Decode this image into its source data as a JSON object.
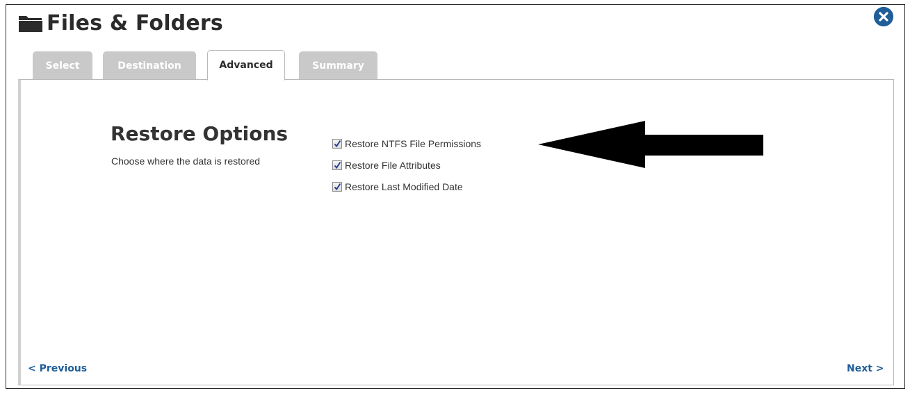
{
  "header": {
    "title": "Files & Folders",
    "icon": "folder-icon",
    "close_icon": "close-icon"
  },
  "tabs": [
    {
      "label": "Select",
      "state": "inactive"
    },
    {
      "label": "Destination",
      "state": "inactive"
    },
    {
      "label": "Advanced",
      "state": "active"
    },
    {
      "label": "Summary",
      "state": "inactive"
    }
  ],
  "section": {
    "heading": "Restore Options",
    "subtext": "Choose where the data is restored"
  },
  "options": [
    {
      "label": "Restore NTFS File Permissions",
      "checked": true
    },
    {
      "label": "Restore File Attributes",
      "checked": true
    },
    {
      "label": "Restore Last Modified Date",
      "checked": true
    }
  ],
  "annotation": {
    "arrow_icon": "arrow-left-icon",
    "arrow_color": "#000000"
  },
  "footer": {
    "previous": "< Previous",
    "next": "Next >"
  },
  "colors": {
    "accent": "#1f5e98",
    "tab_inactive": "#c9c9c9"
  }
}
